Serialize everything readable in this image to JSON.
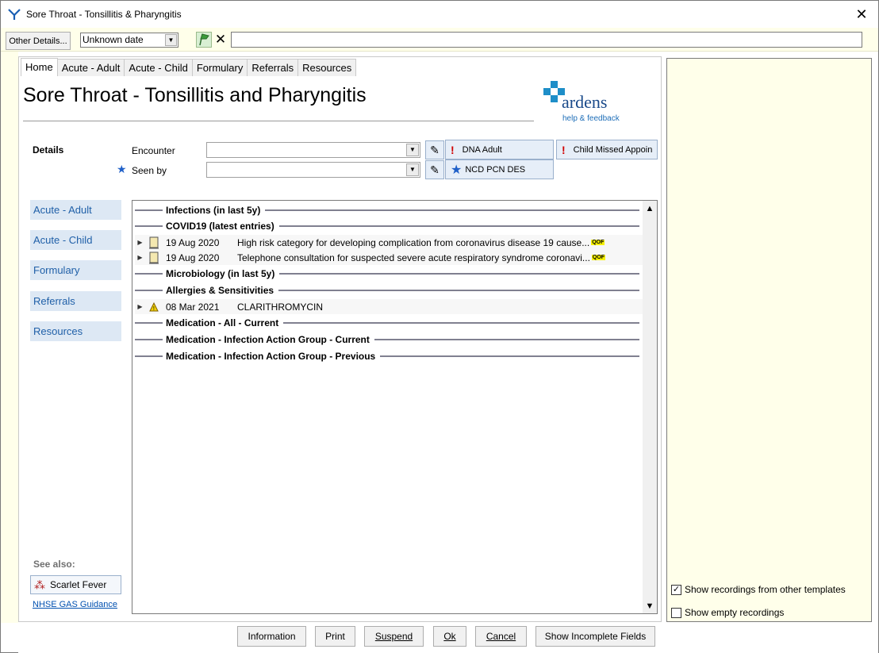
{
  "window": {
    "title": "Sore Throat - Tonsillitis & Pharyngitis",
    "close_glyph": "✕"
  },
  "toolbar": {
    "other_details_label": "Other Details...",
    "date_value": "Unknown date",
    "clear_glyph": "✕",
    "free_text_value": ""
  },
  "tabs": [
    {
      "label": "Home",
      "active": true
    },
    {
      "label": "Acute - Adult"
    },
    {
      "label": "Acute - Child"
    },
    {
      "label": "Formulary"
    },
    {
      "label": "Referrals"
    },
    {
      "label": "Resources"
    }
  ],
  "page": {
    "title": "Sore Throat - Tonsillitis and Pharyngitis"
  },
  "logo": {
    "name": "ardens",
    "subtitle": "help & feedback",
    "accent_color": "#1e8ec8"
  },
  "details": {
    "section_label": "Details",
    "encounter_label": "Encounter",
    "encounter_value": "",
    "seen_by_label": "Seen by",
    "seen_by_value": ""
  },
  "alerts": {
    "dna_adult": "DNA Adult",
    "child_missed": "Child Missed Appoin",
    "ncd_pcn": "NCD PCN DES"
  },
  "side_nav": [
    "Acute - Adult",
    "Acute - Child",
    "Formulary",
    "Referrals",
    "Resources"
  ],
  "see_also": {
    "label": "See also:",
    "scarlet_fever": "Scarlet Fever",
    "nhse_link": "NHSE GAS Guidance"
  },
  "list": {
    "sections": [
      "Infections (in last 5y)",
      "COVID19 (latest entries)",
      "Microbiology (in last 5y)",
      "Allergies & Sensitivities",
      "Medication - All - Current",
      "Medication - Infection Action Group - Current",
      "Medication - Infection Action Group - Previous"
    ],
    "covid_entries": [
      {
        "date": "19 Aug 2020",
        "text": "High risk category for developing complication from coronavirus disease 19 cause...",
        "badge": "QOF"
      },
      {
        "date": "19 Aug 2020",
        "text": "Telephone consultation for suspected severe acute respiratory syndrome coronavi...",
        "badge": "QOF"
      }
    ],
    "allergy_entries": [
      {
        "date": "08 Mar 2021",
        "text": "CLARITHROMYCIN"
      }
    ]
  },
  "right_panel": {
    "show_other_templates": "Show recordings from other templates",
    "show_other_checked": true,
    "show_empty": "Show empty recordings",
    "show_empty_checked": false
  },
  "buttons": {
    "information": "Information",
    "print": "Print",
    "suspend": "Suspend",
    "ok": "Ok",
    "cancel": "Cancel",
    "show_incomplete": "Show Incomplete Fields"
  },
  "colors": {
    "panel_yellow": "#ffffea",
    "nav_blue": "#dde8f4",
    "link_blue": "#2060a8",
    "alert_red": "#d00000"
  }
}
